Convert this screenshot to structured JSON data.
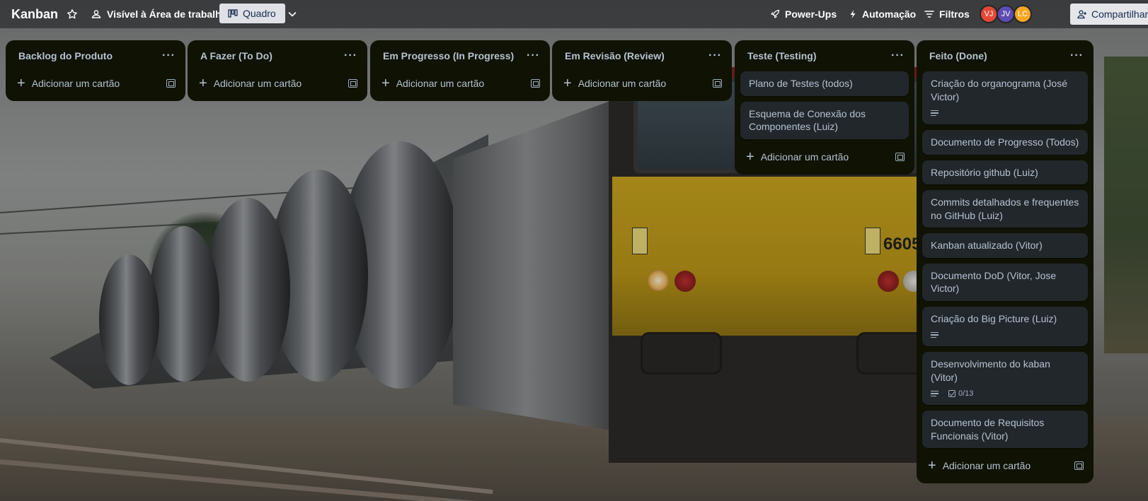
{
  "board": {
    "title": "Kanban",
    "visibility_label": "Visível à Área de trabalho",
    "view_label": "Quadro"
  },
  "header": {
    "powerups_label": "Power-Ups",
    "automation_label": "Automação",
    "filters_label": "Filtros",
    "share_label": "Compartilhar",
    "members": [
      {
        "initials": "VJ",
        "color": "#e34935"
      },
      {
        "initials": "JV",
        "color": "#5e4db2"
      },
      {
        "initials": "LC",
        "color": "#f5a623"
      }
    ]
  },
  "add_card_label": "Adicionar um cartão",
  "lists": [
    {
      "title": "Backlog do Produto",
      "cards": []
    },
    {
      "title": "A Fazer (To Do)",
      "cards": []
    },
    {
      "title": "Em Progresso (In Progress)",
      "cards": []
    },
    {
      "title": "Em Revisão (Review)",
      "cards": []
    },
    {
      "title": "Teste (Testing)",
      "cards": [
        {
          "title": "Plano de Testes (todos)"
        },
        {
          "title": "Esquema de Conexão dos Componentes (Luiz)"
        }
      ]
    },
    {
      "title": "Feito (Done)",
      "cards": [
        {
          "title": "Criação do organograma (José Victor)",
          "description": true
        },
        {
          "title": "Documento de Progresso (Todos)"
        },
        {
          "title": "Repositório github (Luiz)"
        },
        {
          "title": "Commits detalhados e frequentes no GitHub (Luiz)"
        },
        {
          "title": "Kanban atualizado (Vitor)"
        },
        {
          "title": "Documento DoD (Vitor, Jose Victor)"
        },
        {
          "title": "Criação do Big Picture (Luiz)",
          "description": true
        },
        {
          "title": "Desenvolvimento do kaban (Vitor)",
          "description": true,
          "checklist": "0/13"
        },
        {
          "title": "Documento de Requisitos Funcionais (Vitor)"
        }
      ]
    }
  ],
  "background": {
    "plate_number": "6605"
  }
}
